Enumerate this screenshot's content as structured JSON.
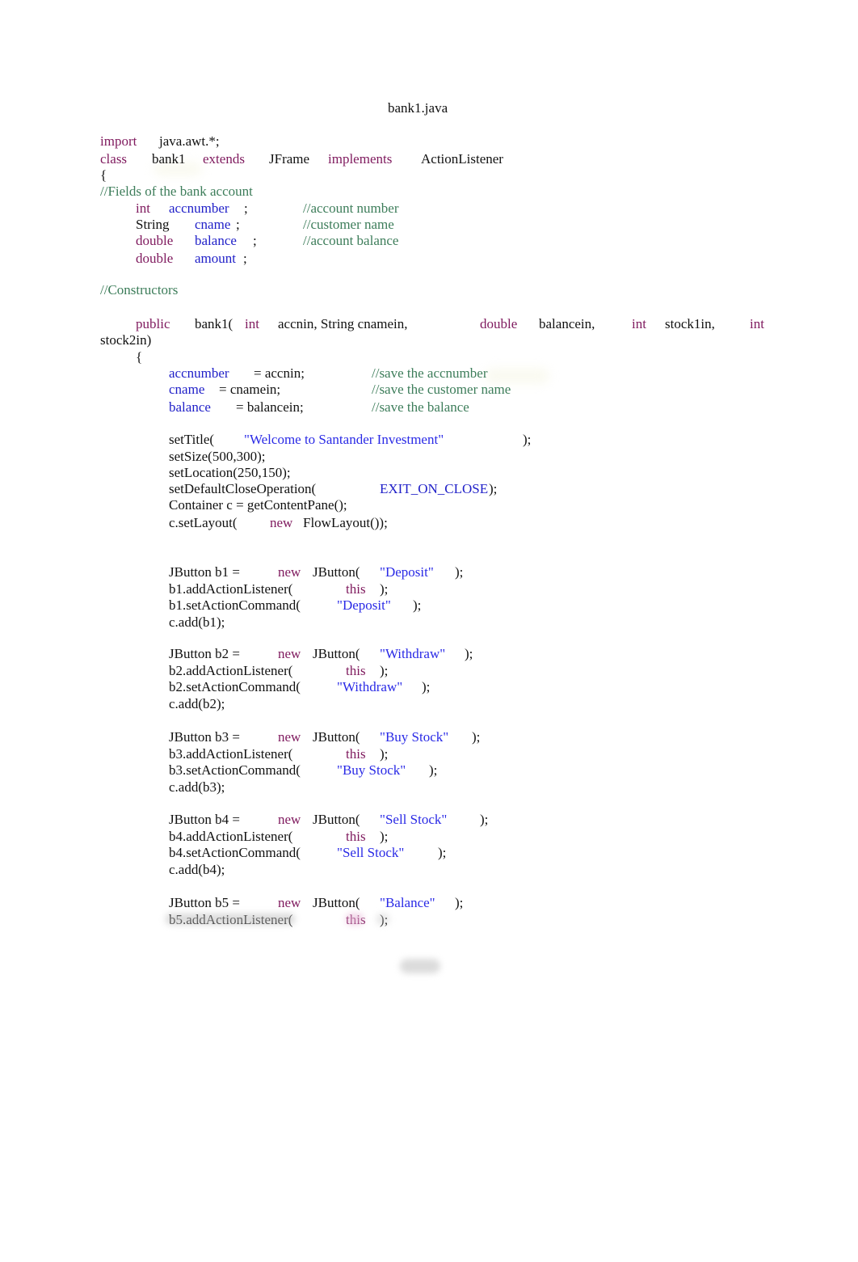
{
  "document": {
    "title": "bank1.java",
    "page_label": "Page 1"
  },
  "colors": {
    "keyword": "#7f1a5e",
    "identifier": "#1f1fc8",
    "string": "#2a2ae6",
    "comment": "#3d7d5a",
    "plain": "#111111"
  },
  "code": {
    "import_kw": "import",
    "import_pkg": "java.awt.*;",
    "class_kw": "class",
    "class_name": "bank1",
    "extends_kw": "extends",
    "super_class": "JFrame",
    "implements_kw": "implements",
    "interface": "ActionListener",
    "open_brace": "{",
    "fields_comment": "//Fields of the bank account",
    "fields": [
      {
        "type": "int",
        "name": "accnumber",
        "semi": ";",
        "comment": "//account number"
      },
      {
        "type": "String",
        "name": "cname",
        "semi": ";",
        "comment": "//customer name"
      },
      {
        "type": "double",
        "name": "balance",
        "semi": ";",
        "comment": "//account balance"
      },
      {
        "type": "double",
        "name": "amount",
        "semi": ";",
        "comment": ""
      }
    ],
    "constructors_comment": "//Constructors",
    "ctor": {
      "public_kw": "public",
      "name": "bank1(",
      "int1": "int",
      "params1": "accnin, String cnamein,",
      "double_kw": "double",
      "balancein": "balancein,",
      "int2": "int",
      "stock1in": "stock1in,",
      "int3": "int",
      "stock2in": "stock2in)",
      "open_brace": "{"
    },
    "assignments": [
      {
        "lhs": "accnumber",
        "rhs": "= accnin;",
        "comment": "//save the accnumber"
      },
      {
        "lhs": "cname",
        "rhs": "= cnamein;",
        "comment": "//save the customer name"
      },
      {
        "lhs": "balance",
        "rhs": "= balancein;",
        "comment": "//save the balance"
      }
    ],
    "setup": {
      "set_title": "setTitle(",
      "title_string": "\"Welcome to Santander Investment\"",
      "title_close": ");",
      "set_size": "setSize(500,300);",
      "set_location": "setLocation(250,150);",
      "set_close_op": "setDefaultCloseOperation(",
      "exit_const": "EXIT_ON_CLOSE",
      "close_op_end": ");",
      "container": "Container c = getContentPane();",
      "set_layout": "c.setLayout(",
      "new_kw": "new",
      "flow_layout": "FlowLayout());"
    },
    "buttons": [
      {
        "decl": "JButton b1 =",
        "new_kw": "new",
        "ctor": "JButton(",
        "label": "\"Deposit\"",
        "end": ");",
        "listener": "b1.addActionListener(",
        "this_kw": "this",
        "listener_end": ");",
        "set_cmd": "b1.setActionCommand(",
        "cmd": "\"Deposit\"",
        "cmd_end": ");",
        "add": "c.add(b1);"
      },
      {
        "decl": "JButton b2 =",
        "new_kw": "new",
        "ctor": "JButton(",
        "label": "\"Withdraw\"",
        "end": ");",
        "listener": "b2.addActionListener(",
        "this_kw": "this",
        "listener_end": ");",
        "set_cmd": "b2.setActionCommand(",
        "cmd": "\"Withdraw\"",
        "cmd_end": ");",
        "add": "c.add(b2);"
      },
      {
        "decl": "JButton b3 =",
        "new_kw": "new",
        "ctor": "JButton(",
        "label": "\"Buy Stock\"",
        "end": ");",
        "listener": "b3.addActionListener(",
        "this_kw": "this",
        "listener_end": ");",
        "set_cmd": "b3.setActionCommand(",
        "cmd": "\"Buy Stock\"",
        "cmd_end": ");",
        "add": "c.add(b3);"
      },
      {
        "decl": "JButton b4 =",
        "new_kw": "new",
        "ctor": "JButton(",
        "label": "\"Sell Stock\"",
        "end": ");",
        "listener": "b4.addActionListener(",
        "this_kw": "this",
        "listener_end": ");",
        "set_cmd": "b4.setActionCommand(",
        "cmd": "\"Sell Stock\"",
        "cmd_end": ");",
        "add": "c.add(b4);"
      },
      {
        "decl": "JButton b5 =",
        "new_kw": "new",
        "ctor": "JButton(",
        "label": "\"Balance\"",
        "end": ");",
        "listener": "b5.addActionListener(",
        "this_kw": "this",
        "listener_end": ");"
      }
    ]
  }
}
